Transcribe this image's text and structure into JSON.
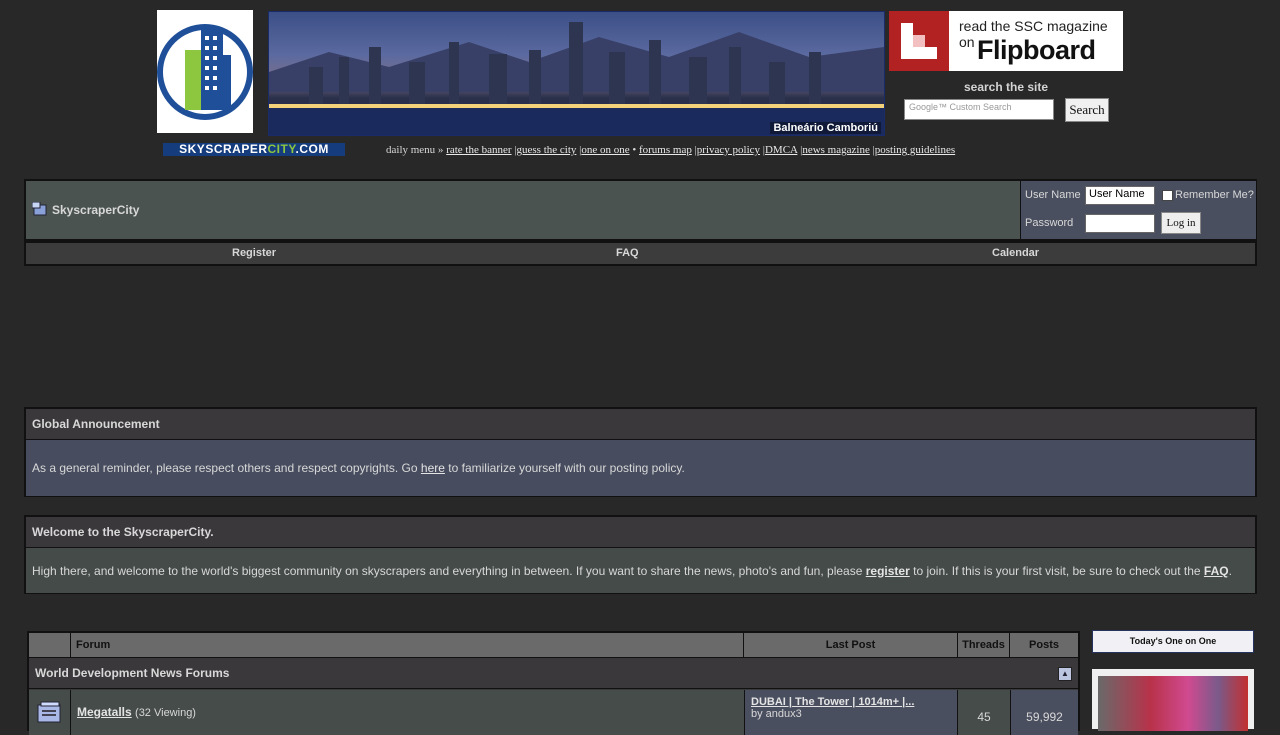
{
  "header": {
    "banner_caption": "Balneário Camboriú",
    "flipboard_line1": "read the SSC magazine on",
    "flipboard_line2": "Flipboard",
    "search_label": "search the site",
    "search_placeholder": "Google™ Custom Search",
    "search_button": "Search",
    "site_name_a": "SKYSCRAPER",
    "site_name_b": "CITY",
    "site_name_c": ".COM"
  },
  "daily_menu": {
    "prefix": "daily menu »",
    "links": [
      "rate the banner",
      "guess the city",
      "one on one",
      "forums map",
      "privacy policy",
      "DMCA",
      "news magazine",
      "posting guidelines"
    ],
    "separators": [
      "|",
      "|",
      "•",
      "|",
      "|",
      "|",
      "|"
    ]
  },
  "navbar": {
    "breadcrumb": "SkyscraperCity",
    "user_label": "User Name",
    "user_value": "User Name",
    "remember_label": "Remember Me?",
    "password_label": "Password",
    "login_button": "Log in"
  },
  "menu": [
    "Register",
    "FAQ",
    "Calendar"
  ],
  "announcement": {
    "title": "Global Announcement",
    "text_before": "As a general reminder, please respect others and respect copyrights. Go",
    "link": "here",
    "text_after": "to familiarize yourself with our posting policy."
  },
  "welcome": {
    "title": "Welcome to the SkyscraperCity.",
    "text1": "High there, and welcome to the world's biggest community on skyscrapers and everything in between. If you want to share the news, photo's and fun, please",
    "link_register": "register",
    "text2": "to join. If this is your first visit, be sure to check out the",
    "link_faq": "FAQ",
    "text3": "."
  },
  "forum_table": {
    "columns": [
      "Forum",
      "Last Post",
      "Threads",
      "Posts"
    ],
    "category": "World Development News Forums",
    "rows": [
      {
        "name": "Megatalls",
        "viewing": "(32 Viewing)",
        "last_post_title": "DUBAI | The Tower | 1014m+ |...",
        "last_post_by": "by andux3",
        "threads": "45",
        "posts": "59,992"
      }
    ]
  },
  "sidebar": {
    "one_on_one_title": "Today's One on One"
  },
  "colors": {
    "background": "#282828",
    "panel_head": "#3b383b",
    "navbar_bg": "#4a5350",
    "login_bg": "#4a4f5f",
    "site_blue": "#153c7c",
    "site_green": "#8dc63f"
  }
}
